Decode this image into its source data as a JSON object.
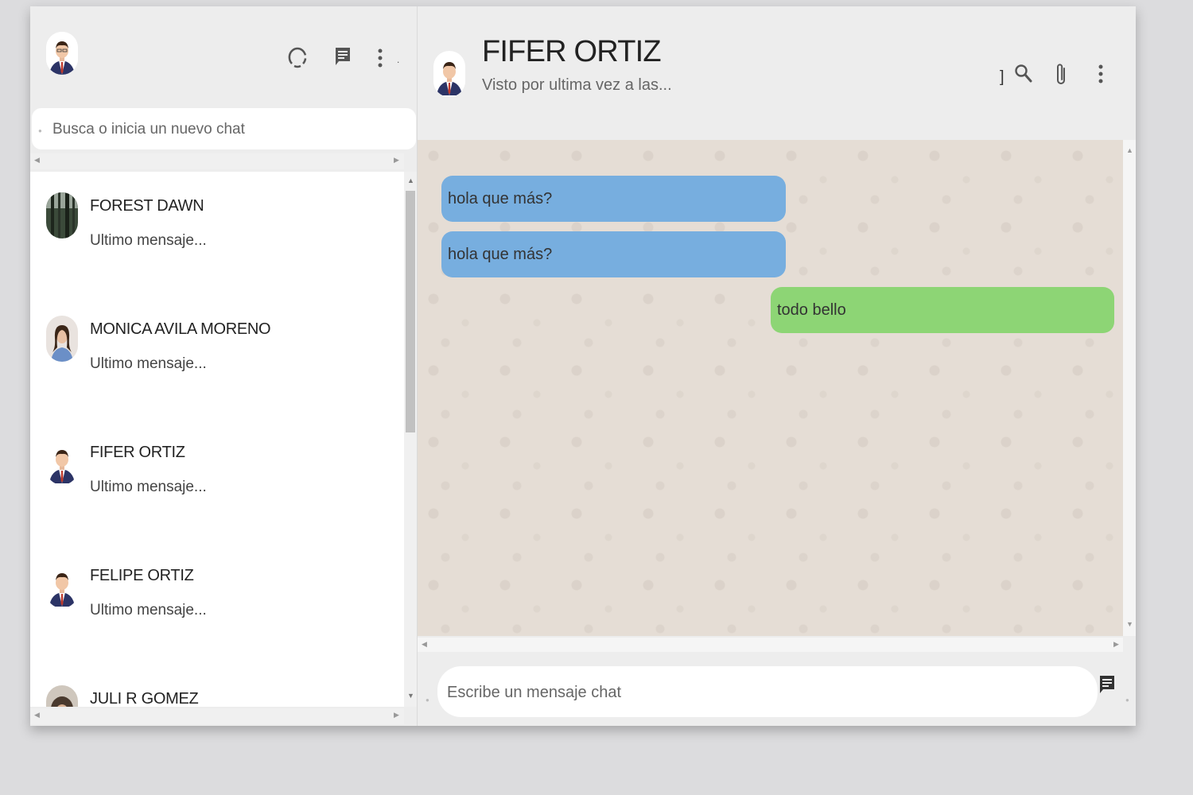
{
  "left_header": {
    "icons": [
      "status-icon",
      "new-chat-icon",
      "menu-icon"
    ],
    "trailing_mark": "."
  },
  "search": {
    "placeholder": "Busca o inicia un nuevo chat"
  },
  "chats": [
    {
      "name": "FOREST DAWN",
      "last_message": "Ultimo mensaje..."
    },
    {
      "name": "MONICA AVILA MORENO",
      "last_message": "Ultimo mensaje..."
    },
    {
      "name": "FIFER ORTIZ",
      "last_message": "Ultimo mensaje..."
    },
    {
      "name": "FELIPE ORTIZ",
      "last_message": "Ultimo mensaje..."
    },
    {
      "name": "JULI R GOMEZ",
      "last_message": ""
    }
  ],
  "conversation": {
    "contact_name": "FIFER ORTIZ",
    "status": "Visto por ultima vez a las...",
    "header_mark": "]",
    "icons": [
      "search-icon",
      "attach-icon",
      "menu-icon"
    ],
    "messages": [
      {
        "text": "hola que más?",
        "direction": "incoming"
      },
      {
        "text": "hola que más?",
        "direction": "incoming"
      },
      {
        "text": "todo bello",
        "direction": "outgoing"
      }
    ]
  },
  "composer": {
    "placeholder": "Escribe un mensaje chat",
    "send_icon": "message-icon"
  },
  "colors": {
    "incoming_bubble": "#77aedf",
    "outgoing_bubble": "#8dd575",
    "chat_background": "#e5ddd5",
    "panel_background": "#ededed"
  }
}
